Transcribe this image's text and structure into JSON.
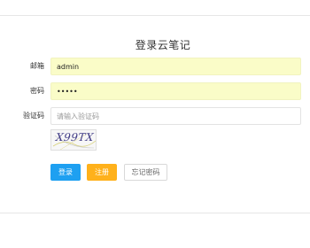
{
  "form": {
    "title": "登录云笔记",
    "email": {
      "label": "邮箱",
      "value": "admin"
    },
    "password": {
      "label": "密码",
      "value": "•••••"
    },
    "captcha": {
      "label": "验证码",
      "placeholder": "请输入验证码",
      "image_text": "X99TX"
    },
    "buttons": {
      "login": "登录",
      "register": "注册",
      "forgot": "忘记密码"
    }
  },
  "colors": {
    "autofill_bg": "#fafcc8",
    "login_button": "#1ea0f1",
    "register_button": "#ffb11b",
    "captcha_text": "#3f3a85"
  }
}
